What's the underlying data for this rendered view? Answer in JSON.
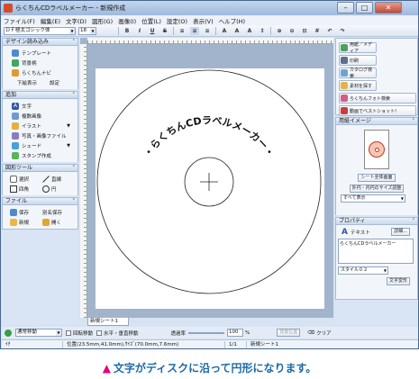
{
  "window": {
    "title": "らくちんCDラベルメーカー - 新規作成"
  },
  "menu": [
    "ファイル(F)",
    "編集(E)",
    "文字(D)",
    "図形(G)",
    "画像(I)",
    "位置(L)",
    "設定(O)",
    "表示(V)",
    "ヘルプ(H)"
  ],
  "toolbar": {
    "font": "ＤＦ極太ゴシック体",
    "size": "18",
    "style_buttons": [
      "B",
      "I",
      "U",
      "S"
    ]
  },
  "left_panel": {
    "design": {
      "title": "デザイン読み込み",
      "items": [
        "テンプレート",
        "背景柄",
        "らくちんナビ"
      ],
      "links": [
        "下絵表示",
        "設定"
      ]
    },
    "add": {
      "title": "追加",
      "items": [
        "文字",
        "複数画像",
        "イラスト",
        "写真・画像ファイル",
        "シェード",
        "スタンプ作成"
      ]
    },
    "shape_tools": {
      "title": "図形ツール",
      "items": [
        "選択",
        "直線",
        "四角",
        "円"
      ]
    },
    "file": {
      "title": "ファイル",
      "items": [
        "保存",
        "別名保存",
        "新規",
        "開く"
      ]
    }
  },
  "canvas": {
    "disc_text": "・らくちんCDラベルメーカー・",
    "sheet_tab": "新規シート1"
  },
  "right_panel": {
    "buttons": [
      "用紙／メディア",
      "印刷",
      "カタログ検索",
      "素材を探す",
      "らくちんフォト検索",
      "動画でベストショット!"
    ],
    "paper_image": {
      "title": "用紙イメージ",
      "full_view": "シート全体画面",
      "size_adjust": "外円・内円のサイズ調整",
      "display": "すべて表示"
    },
    "properties": {
      "title": "プロパティ",
      "type": "テキスト",
      "detail": "詳細...",
      "text_value": "らくちんCDラベルメーカー",
      "style": "スタイル０２",
      "transform": "文字変形"
    }
  },
  "bottom_bar": {
    "mode": "通常移動",
    "rotate": "回転移動",
    "hv": "水平・垂直移動",
    "transparency_label": "透過率",
    "transparency_value": "100",
    "unit": "%",
    "bg_position": "背景位置",
    "clear": "クリア"
  },
  "status_bar": {
    "pos": "ｲﾁ(258.9mm,122.0mm)",
    "info1": "位置(23.5mm,41.0mm),ｻｲｽﾞ(70.0mm,7.6mm)",
    "page": "1/1",
    "sheet": "新規シート1"
  },
  "caption": {
    "marker": "▲",
    "text": "文字がディスクに沿って円形になります。"
  }
}
